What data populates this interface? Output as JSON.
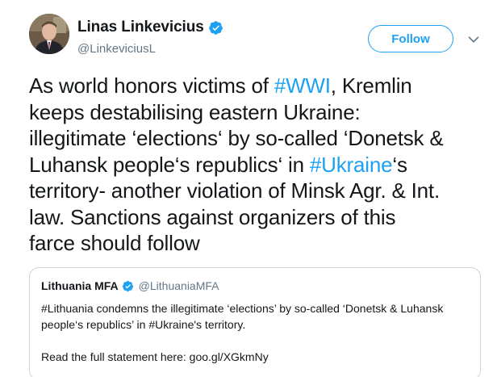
{
  "author": {
    "display_name": "Linas Linkevicius",
    "handle": "@LinkeviciusL",
    "verified": true
  },
  "actions": {
    "follow_label": "Follow"
  },
  "tweet": {
    "lines": [
      [
        {
          "t": "As world honors victims of "
        },
        {
          "t": "#WWI",
          "tag": true
        },
        {
          "t": ", Kremlin"
        }
      ],
      [
        {
          "t": "keeps destabilising eastern Ukraine:"
        }
      ],
      [
        {
          "t": "illegitimate ‘elections‘ by so-called ‘Donetsk &"
        }
      ],
      [
        {
          "t": "Luhansk people‘s republics‘ in "
        },
        {
          "t": "#Ukraine",
          "tag": true
        },
        {
          "t": "‘s"
        }
      ],
      [
        {
          "t": "territory- another violation of Minsk Agr. & Int."
        }
      ],
      [
        {
          "t": "law. Sanctions against organizers of this"
        }
      ],
      [
        {
          "t": "farce should follow"
        }
      ]
    ]
  },
  "quoted_tweet": {
    "display_name": "Lithuania MFA",
    "handle": "@LithuaniaMFA",
    "verified": true,
    "lines": [
      "#Lithuania condemns the illegitimate ‘elections’ by so-called ‘Donetsk & Luhansk",
      "people‘s republics’ in #Ukraine's territory.",
      "",
      "Read the full statement here: goo.gl/XGkmNy"
    ]
  },
  "colors": {
    "accent": "#1da1f2",
    "text": "#14171a",
    "secondary_text": "#657786",
    "border": "#ccd6dd"
  },
  "icons": {
    "verified": "verified-badge-icon",
    "caret": "chevron-down-icon"
  }
}
